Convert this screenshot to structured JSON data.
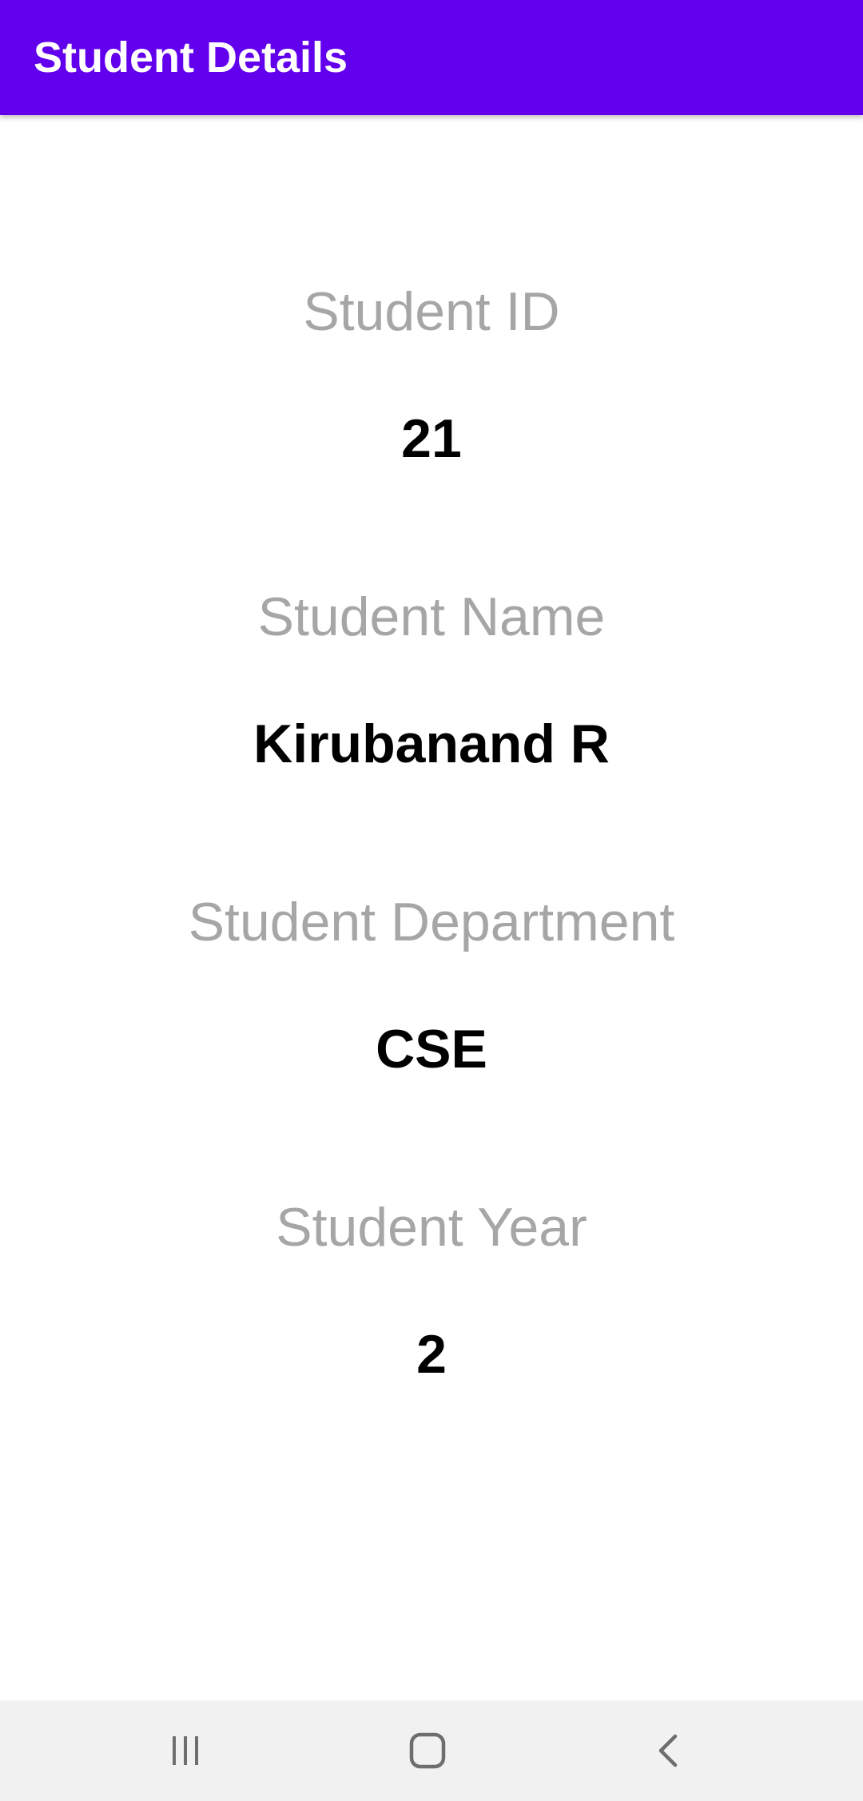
{
  "app_bar": {
    "title": "Student Details",
    "color": "#6200EE"
  },
  "fields": [
    {
      "label": "Student ID",
      "value": "21"
    },
    {
      "label": "Student Name",
      "value": "Kirubanand R"
    },
    {
      "label": "Student Department",
      "value": "CSE"
    },
    {
      "label": "Student Year",
      "value": "2"
    }
  ],
  "colors": {
    "label": "#A6A6A6",
    "value": "#000000",
    "nav_bar": "#F1F1F1"
  },
  "nav": {
    "recents_icon": "recents-icon",
    "home_icon": "home-icon",
    "back_icon": "back-icon"
  }
}
